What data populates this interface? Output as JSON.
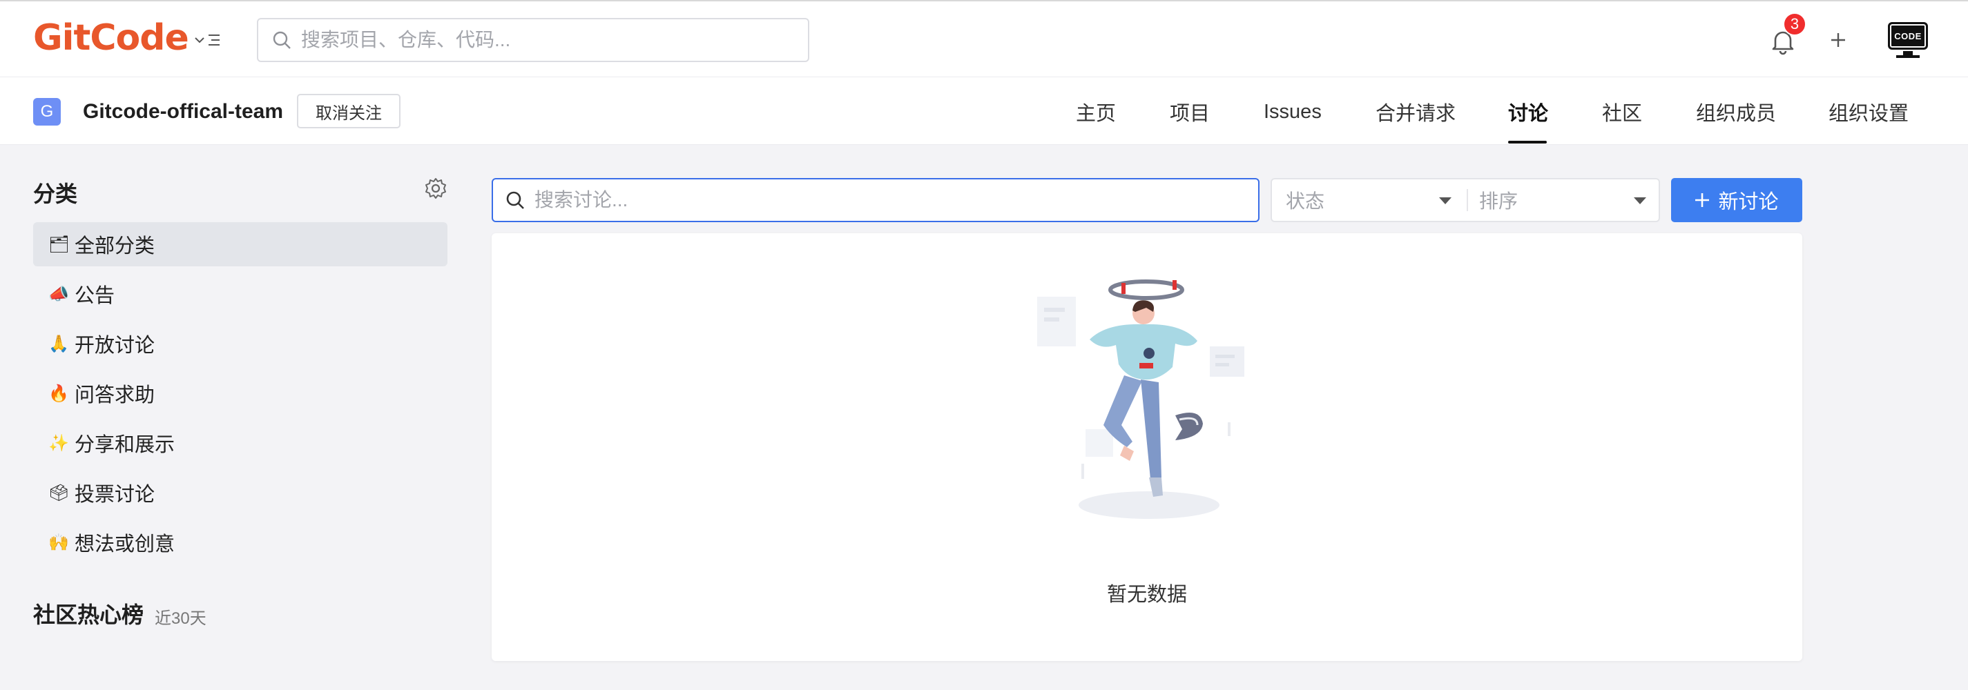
{
  "header": {
    "logo_text": "GitCode",
    "search_placeholder": "搜索项目、仓库、代码...",
    "notification_count": "3",
    "avatar_text": "CODE"
  },
  "org": {
    "avatar_letter": "G",
    "name": "Gitcode-offical-team",
    "unfollow_label": "取消关注",
    "tabs": [
      {
        "label": "主页"
      },
      {
        "label": "项目"
      },
      {
        "label": "Issues"
      },
      {
        "label": "合并请求"
      },
      {
        "label": "讨论",
        "active": true
      },
      {
        "label": "社区"
      },
      {
        "label": "组织成员"
      },
      {
        "label": "组织设置"
      }
    ]
  },
  "sidebar": {
    "title": "分类",
    "categories": [
      {
        "icon": "🗂",
        "label": "全部分类"
      },
      {
        "icon": "📣",
        "label": "公告"
      },
      {
        "icon": "🙏",
        "label": "开放讨论"
      },
      {
        "icon": "🔥",
        "label": "问答求助"
      },
      {
        "icon": "✨",
        "label": "分享和展示"
      },
      {
        "icon": "🗳",
        "label": "投票讨论"
      },
      {
        "icon": "🙌",
        "label": "想法或创意"
      }
    ],
    "heat_title": "社区热心榜",
    "heat_subtitle": "近30天"
  },
  "main": {
    "search_placeholder": "搜索讨论...",
    "status_placeholder": "状态",
    "sort_placeholder": "排序",
    "new_button_label": "新讨论",
    "empty_text": "暂无数据"
  },
  "colors": {
    "brand": "#e8572b",
    "primary": "#3d7ef0",
    "badge": "#f02d2d"
  }
}
